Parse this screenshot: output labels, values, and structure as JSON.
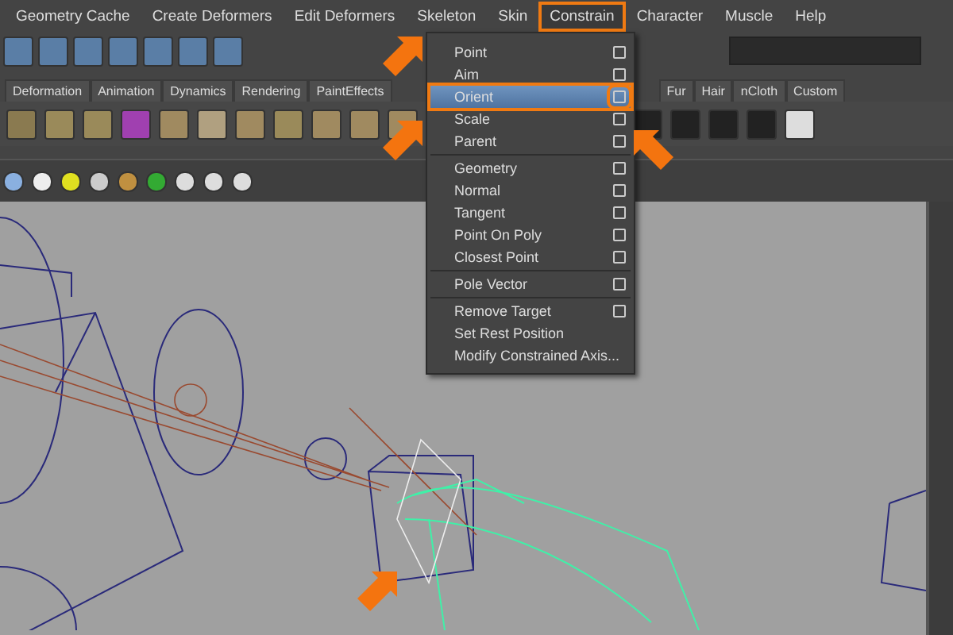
{
  "menu_bar": {
    "items": [
      {
        "label": "Geometry Cache",
        "selected": false
      },
      {
        "label": "Create Deformers",
        "selected": false
      },
      {
        "label": "Edit Deformers",
        "selected": false
      },
      {
        "label": "Skeleton",
        "selected": false
      },
      {
        "label": "Skin",
        "selected": false
      },
      {
        "label": "Constrain",
        "selected": true
      },
      {
        "label": "Character",
        "selected": false
      },
      {
        "label": "Muscle",
        "selected": false
      },
      {
        "label": "Help",
        "selected": false
      }
    ]
  },
  "shelf_tabs": {
    "before_menu": [
      "Deformation",
      "Animation",
      "Dynamics",
      "Rendering",
      "PaintEffects"
    ],
    "after_menu": [
      "Fur",
      "Hair",
      "nCloth",
      "Custom"
    ]
  },
  "constrain_menu": {
    "groups": [
      [
        {
          "label": "Point",
          "option_box": true,
          "selected": false
        },
        {
          "label": "Aim",
          "option_box": true,
          "selected": false
        },
        {
          "label": "Orient",
          "option_box": true,
          "selected": true
        },
        {
          "label": "Scale",
          "option_box": true,
          "selected": false
        },
        {
          "label": "Parent",
          "option_box": true,
          "selected": false
        }
      ],
      [
        {
          "label": "Geometry",
          "option_box": true,
          "selected": false
        },
        {
          "label": "Normal",
          "option_box": true,
          "selected": false
        },
        {
          "label": "Tangent",
          "option_box": true,
          "selected": false
        },
        {
          "label": "Point On Poly",
          "option_box": true,
          "selected": false
        },
        {
          "label": "Closest Point",
          "option_box": true,
          "selected": false
        }
      ],
      [
        {
          "label": "Pole Vector",
          "option_box": true,
          "selected": false
        }
      ],
      [
        {
          "label": "Remove Target",
          "option_box": true,
          "selected": false
        },
        {
          "label": "Set Rest Position",
          "option_box": false,
          "selected": false
        },
        {
          "label": "Modify Constrained Axis...",
          "option_box": false,
          "selected": false
        }
      ]
    ]
  }
}
